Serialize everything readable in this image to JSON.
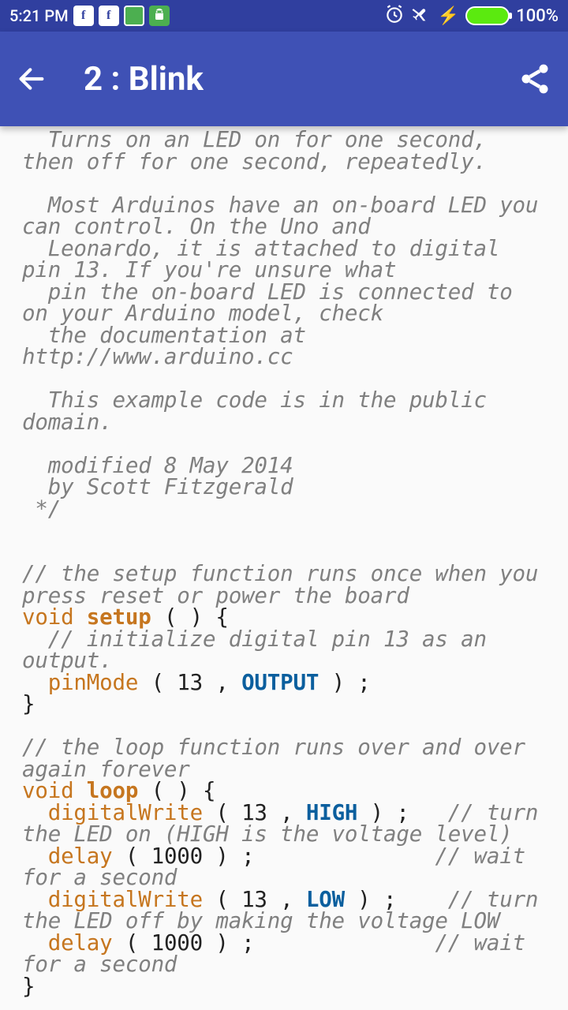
{
  "status": {
    "time": "5:21 PM",
    "battery_percent": "100%"
  },
  "header": {
    "title": "2 : Blink"
  },
  "code": {
    "c1": "  Turns on an LED on for one second, then off for one second, repeatedly.",
    "c2": "  Most Arduinos have an on-board LED you can control. On the Uno and",
    "c3": "  Leonardo, it is attached to digital pin 13. If you're unsure what",
    "c4": "  pin the on-board LED is connected to on your Arduino model, check",
    "c5": "  the documentation at http://www.arduino.cc",
    "c6": "  This example code is in the public domain.",
    "c7": "  modified 8 May 2014",
    "c8": "  by Scott Fitzgerald",
    "c9": " */",
    "c10": "// the setup function runs once when you press reset or power the board",
    "kw_void1": "void",
    "fn_setup": "setup",
    "p_setup": " ( ) {",
    "c11": "  // initialize digital pin 13 as an output.",
    "fn_pinmode": "pinMode",
    "p_pinmode_a": " ( 13 , ",
    "const_output": "OUTPUT",
    "p_pinmode_b": " ) ;",
    "p_close1": "}",
    "c12": "// the loop function runs over and over again forever",
    "kw_void2": "void",
    "fn_loop": "loop",
    "p_loop": " ( ) {",
    "fn_dw1": "digitalWrite",
    "p_dw1a": " ( 13 , ",
    "const_high": "HIGH",
    "p_dw1b": " ) ;   ",
    "c13": "// turn the LED on (HIGH is the voltage level)",
    "fn_delay1": "delay",
    "p_delay1": " ( 1000 ) ;              ",
    "c14": "// wait for a second",
    "fn_dw2": "digitalWrite",
    "p_dw2a": " ( 13 , ",
    "const_low": "LOW",
    "p_dw2b": " ) ;    ",
    "c15": "// turn the LED off by making the voltage LOW",
    "fn_delay2": "delay",
    "p_delay2": " ( 1000 ) ;              ",
    "c16": "// wait for a second",
    "p_close2": "}"
  }
}
